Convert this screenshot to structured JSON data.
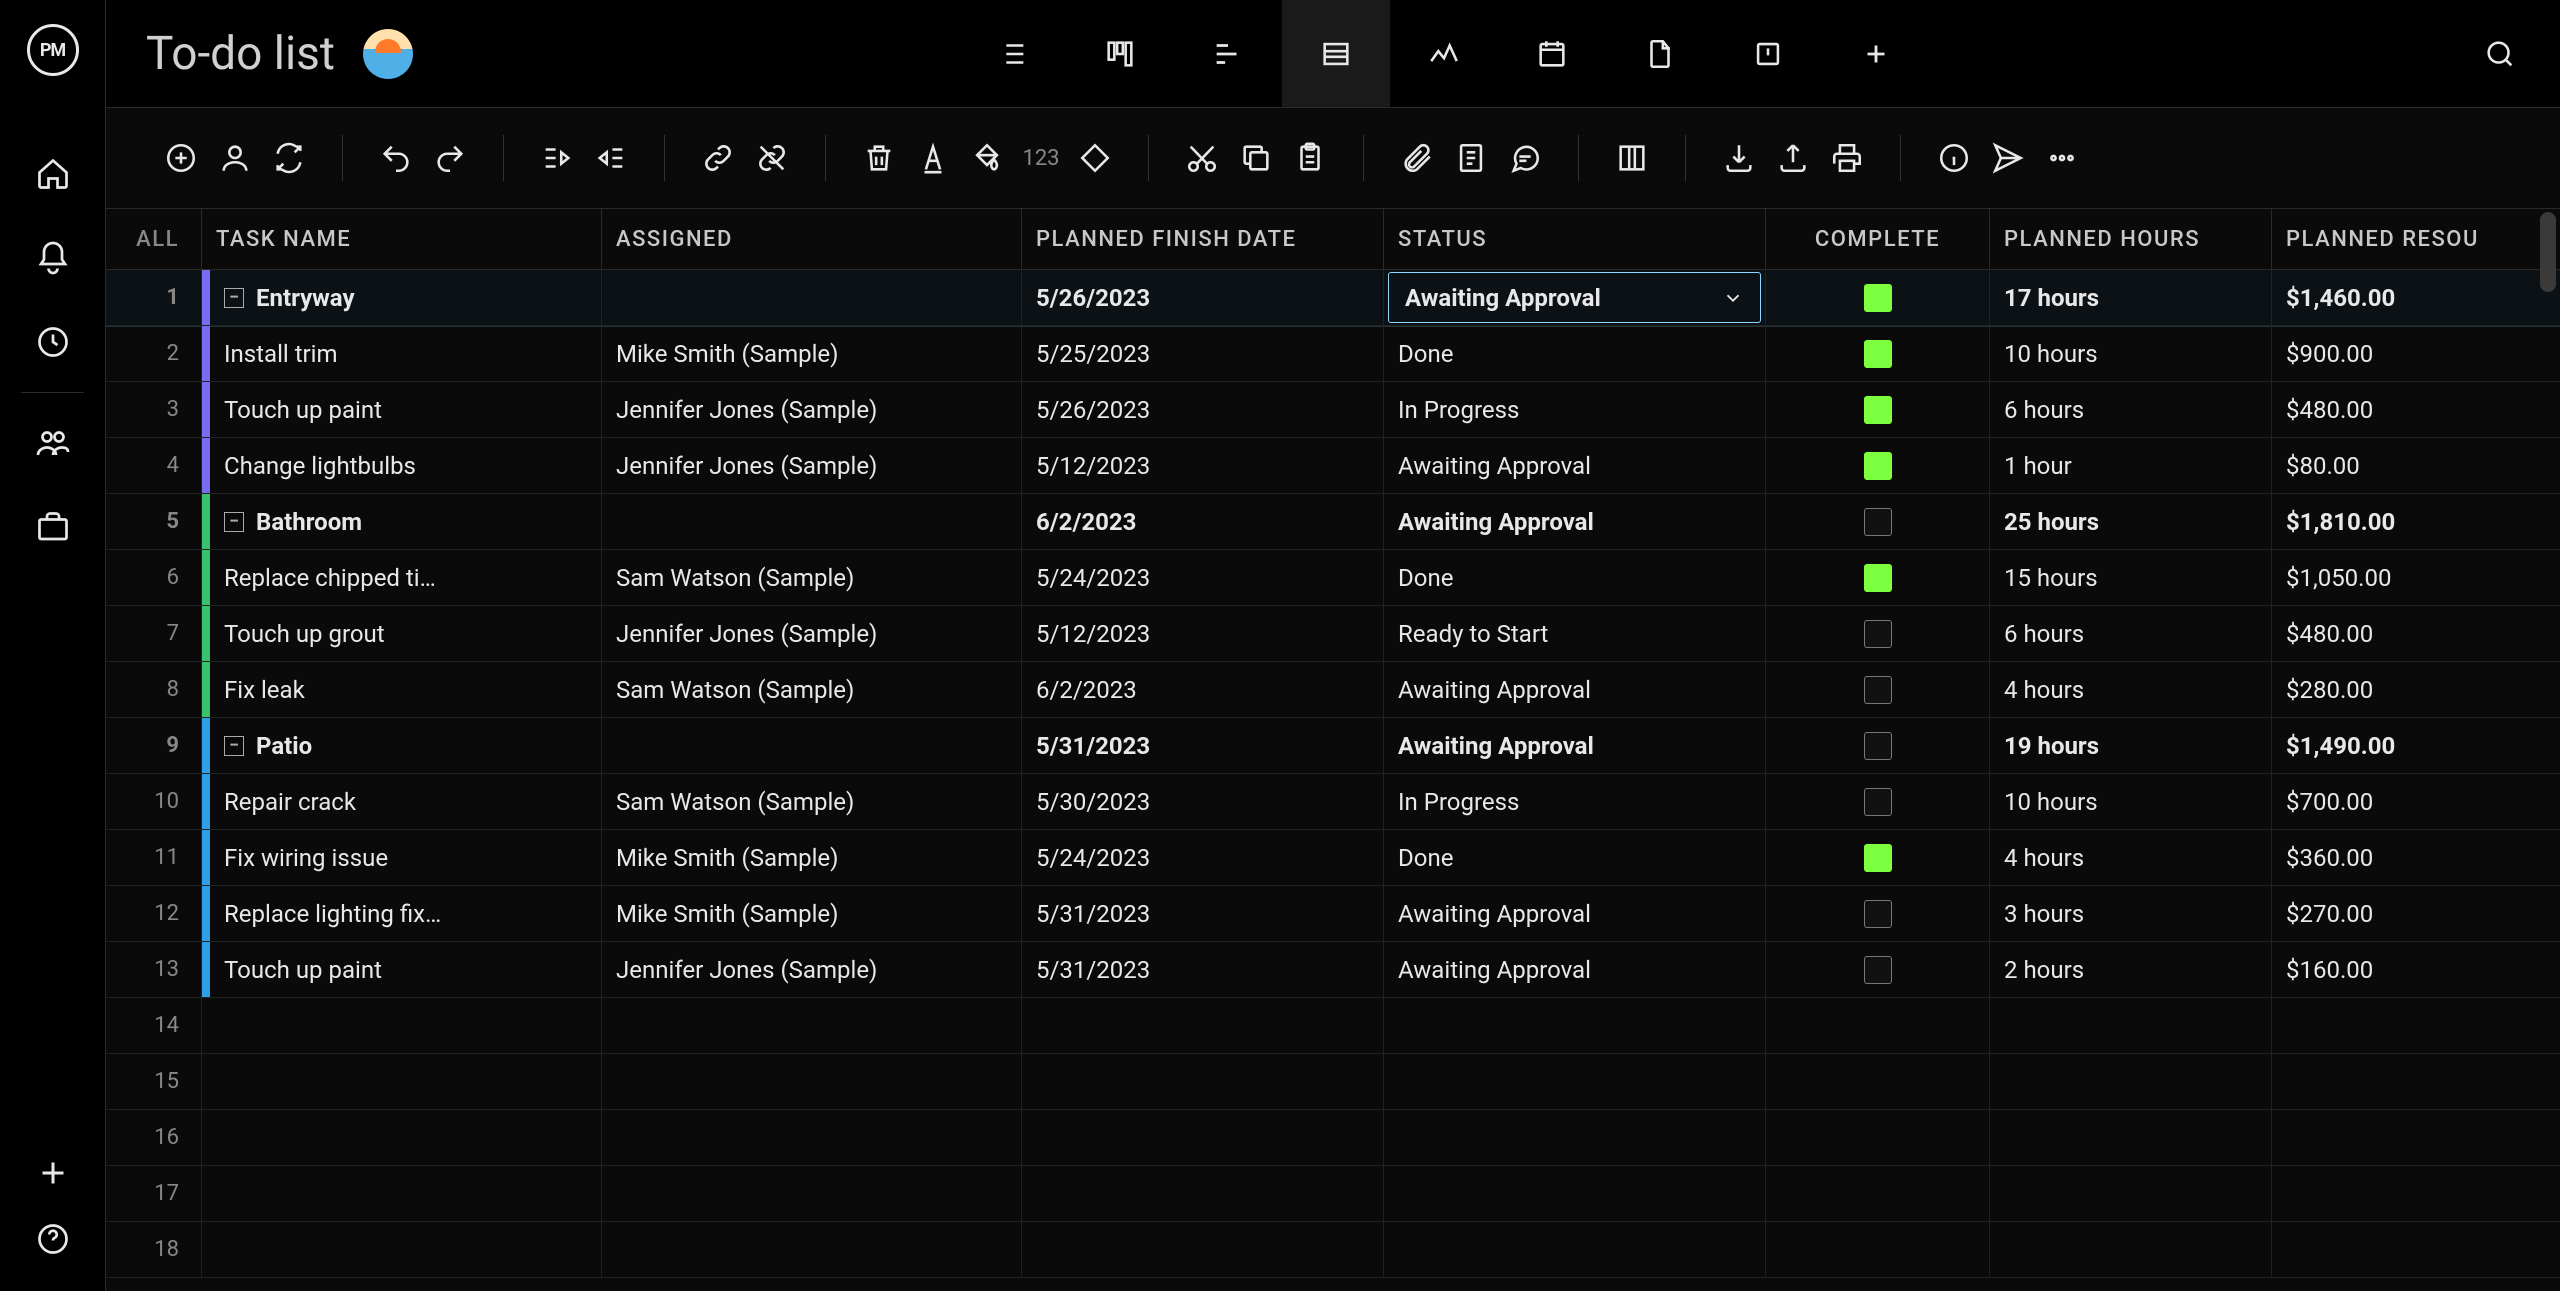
{
  "project_title": "To-do list",
  "brand": "PM",
  "toolbar_number_text": "123",
  "columns": {
    "all": "ALL",
    "task": "TASK NAME",
    "assigned": "ASSIGNED",
    "date": "PLANNED FINISH DATE",
    "status": "STATUS",
    "complete": "COMPLETE",
    "hours": "PLANNED HOURS",
    "cost": "PLANNED RESOU"
  },
  "rows": [
    {
      "n": "1",
      "type": "group",
      "color": "purple",
      "task": "Entryway",
      "assigned": "",
      "date": "5/26/2023",
      "status": "Awaiting Approval",
      "status_dd": true,
      "complete": true,
      "hours": "17 hours",
      "cost": "$1,460.00",
      "selected": true
    },
    {
      "n": "2",
      "type": "item",
      "color": "purple",
      "task": "Install trim",
      "assigned": "Mike Smith (Sample)",
      "date": "5/25/2023",
      "status": "Done",
      "complete": true,
      "hours": "10 hours",
      "cost": "$900.00"
    },
    {
      "n": "3",
      "type": "item",
      "color": "purple",
      "task": "Touch up paint",
      "assigned": "Jennifer Jones (Sample)",
      "date": "5/26/2023",
      "status": "In Progress",
      "complete": true,
      "hours": "6 hours",
      "cost": "$480.00"
    },
    {
      "n": "4",
      "type": "item",
      "color": "purple",
      "task": "Change lightbulbs",
      "assigned": "Jennifer Jones (Sample)",
      "date": "5/12/2023",
      "status": "Awaiting Approval",
      "complete": true,
      "hours": "1 hour",
      "cost": "$80.00"
    },
    {
      "n": "5",
      "type": "group",
      "color": "green",
      "task": "Bathroom",
      "assigned": "",
      "date": "6/2/2023",
      "status": "Awaiting Approval",
      "complete": false,
      "hours": "25 hours",
      "cost": "$1,810.00"
    },
    {
      "n": "6",
      "type": "item",
      "color": "green",
      "task": "Replace chipped ti…",
      "assigned": "Sam Watson (Sample)",
      "date": "5/24/2023",
      "status": "Done",
      "complete": true,
      "hours": "15 hours",
      "cost": "$1,050.00"
    },
    {
      "n": "7",
      "type": "item",
      "color": "green",
      "task": "Touch up grout",
      "assigned": "Jennifer Jones (Sample)",
      "date": "5/12/2023",
      "status": "Ready to Start",
      "complete": false,
      "hours": "6 hours",
      "cost": "$480.00"
    },
    {
      "n": "8",
      "type": "item",
      "color": "green",
      "task": "Fix leak",
      "assigned": "Sam Watson (Sample)",
      "date": "6/2/2023",
      "status": "Awaiting Approval",
      "complete": false,
      "hours": "4 hours",
      "cost": "$280.00"
    },
    {
      "n": "9",
      "type": "group",
      "color": "blue",
      "task": "Patio",
      "assigned": "",
      "date": "5/31/2023",
      "status": "Awaiting Approval",
      "complete": false,
      "hours": "19 hours",
      "cost": "$1,490.00"
    },
    {
      "n": "10",
      "type": "item",
      "color": "blue",
      "task": "Repair crack",
      "assigned": "Sam Watson (Sample)",
      "date": "5/30/2023",
      "status": "In Progress",
      "complete": false,
      "hours": "10 hours",
      "cost": "$700.00"
    },
    {
      "n": "11",
      "type": "item",
      "color": "blue",
      "task": "Fix wiring issue",
      "assigned": "Mike Smith (Sample)",
      "date": "5/24/2023",
      "status": "Done",
      "complete": true,
      "hours": "4 hours",
      "cost": "$360.00"
    },
    {
      "n": "12",
      "type": "item",
      "color": "blue",
      "task": "Replace lighting fix…",
      "assigned": "Mike Smith (Sample)",
      "date": "5/31/2023",
      "status": "Awaiting Approval",
      "complete": false,
      "hours": "3 hours",
      "cost": "$270.00"
    },
    {
      "n": "13",
      "type": "item",
      "color": "blue",
      "task": "Touch up paint",
      "assigned": "Jennifer Jones (Sample)",
      "date": "5/31/2023",
      "status": "Awaiting Approval",
      "complete": false,
      "hours": "2 hours",
      "cost": "$160.00"
    },
    {
      "n": "14",
      "type": "empty"
    },
    {
      "n": "15",
      "type": "empty"
    },
    {
      "n": "16",
      "type": "empty"
    },
    {
      "n": "17",
      "type": "empty"
    },
    {
      "n": "18",
      "type": "empty"
    }
  ]
}
